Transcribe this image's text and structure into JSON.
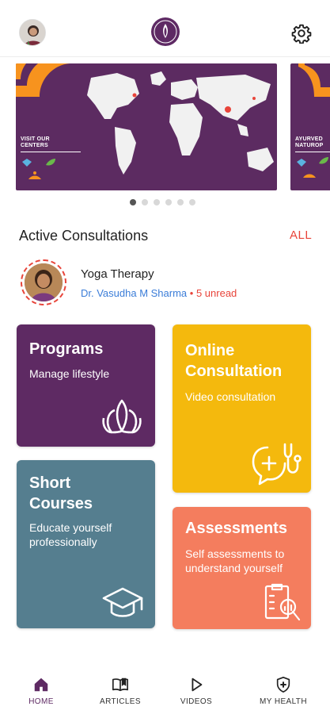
{
  "header": {
    "avatar_icon": "user-avatar",
    "logo_icon": "lotus-flame-logo",
    "settings_icon": "gear-icon"
  },
  "carousel": {
    "banners": [
      {
        "text_line1": "VISIT OUR",
        "text_line2": "CENTERS"
      },
      {
        "text_line1": "AYURVED",
        "text_line2": "NATUROP"
      }
    ],
    "dot_count": 6,
    "active_dot": 0
  },
  "consultations": {
    "title": "Active Consultations",
    "all_label": "ALL",
    "item": {
      "title": "Yoga Therapy",
      "doctor": "Dr. Vasudha M Sharma",
      "separator": "•",
      "unread": "5 unread"
    }
  },
  "tiles": {
    "programs": {
      "title": "Programs",
      "subtitle": "Manage lifestyle",
      "color": "#5e2a63"
    },
    "online": {
      "title_line1": "Online",
      "title_line2": "Consultation",
      "subtitle": "Video consultation",
      "color": "#f4b90d"
    },
    "short": {
      "title_line1": "Short",
      "title_line2": "Courses",
      "subtitle_line1": "Educate yourself",
      "subtitle_line2": "professionally",
      "color": "#557e8f"
    },
    "assess": {
      "title": "Assessments",
      "subtitle_line1": "Self assessments to",
      "subtitle_line2": "understand yourself",
      "color": "#f47d5e"
    }
  },
  "nav": {
    "home": "HOME",
    "articles": "ARTICLES",
    "videos": "VIDEOS",
    "health": "MY HEALTH"
  },
  "colors": {
    "brand": "#5e2a63",
    "accent": "#e8443a",
    "link": "#3b7dd8"
  }
}
